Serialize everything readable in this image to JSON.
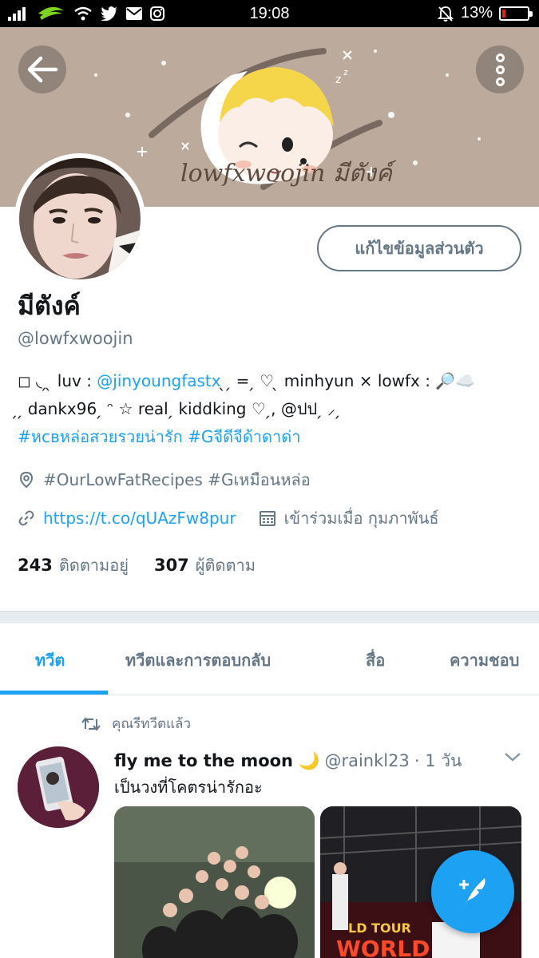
{
  "status_bar": {
    "time": "19:08",
    "battery_text": "13%",
    "battery_level": 0.13,
    "icons": [
      "signal-icon",
      "carrier-icon",
      "wifi-icon",
      "twitter-icon",
      "mail-icon",
      "instagram-icon",
      "mute-bell-icon",
      "battery-icon"
    ]
  },
  "header": {
    "banner_text": "lowfxwoojin มีตังค์",
    "banner_color": "#bcaa9c",
    "back_icon": "arrow-left-icon",
    "more_icon": "more-vertical-icon"
  },
  "profile": {
    "edit_button": "แก้ไขข้อมูลส่วนตัว",
    "name": "มีตังค์",
    "handle": "@lowfxwoojin",
    "bio": {
      "line1_pre": "◻︎ ◟ ̗  ̖ luv : ",
      "line1_link": "@jinyoungfastx",
      "line1_post": " ̖ ̗ = ̗ ♡ ̖ minhyun × lowfx : 🔎☁️",
      "line2": " ̗  ̗ dankx96  ̗ ᵔ ☆ real  ̗ kiddking ♡ ̗, @ปป  ̗ ⸝ ̗",
      "hashtag1": "#หcвหล่อสวยรวยน่ารัก",
      "hashtag2": "#Gจีดีจีด้าดาด่า"
    },
    "location": "#OurLowFatRecipes #Gเหมือนหล่อ",
    "url": "https://t.co/qUAzFw8pur",
    "joined": "เข้าร่วมเมื่อ กุมภาพันธ์",
    "following_count": "243",
    "following_label": "ติดตามอยู่",
    "followers_count": "307",
    "followers_label": "ผู้ติดตาม"
  },
  "tabs": [
    {
      "label": "ทวีต",
      "active": true
    },
    {
      "label": "ทวีตและการตอบกลับ",
      "active": false
    },
    {
      "label": "สื่อ",
      "active": false
    },
    {
      "label": "ความชอบ",
      "active": false
    }
  ],
  "tweet": {
    "retweet_label": "คุณรีทวีตแล้ว",
    "display_name": "fly me to the moon 🌙",
    "username": "@rainkl23",
    "time": "· 1 วัน",
    "text": "เป็นวงที่โคตรน่ารักอะ"
  },
  "fab": {
    "icon": "compose-tweet-icon"
  },
  "colors": {
    "accent": "#1da1f2",
    "muted": "#657786",
    "text": "#14171a"
  }
}
